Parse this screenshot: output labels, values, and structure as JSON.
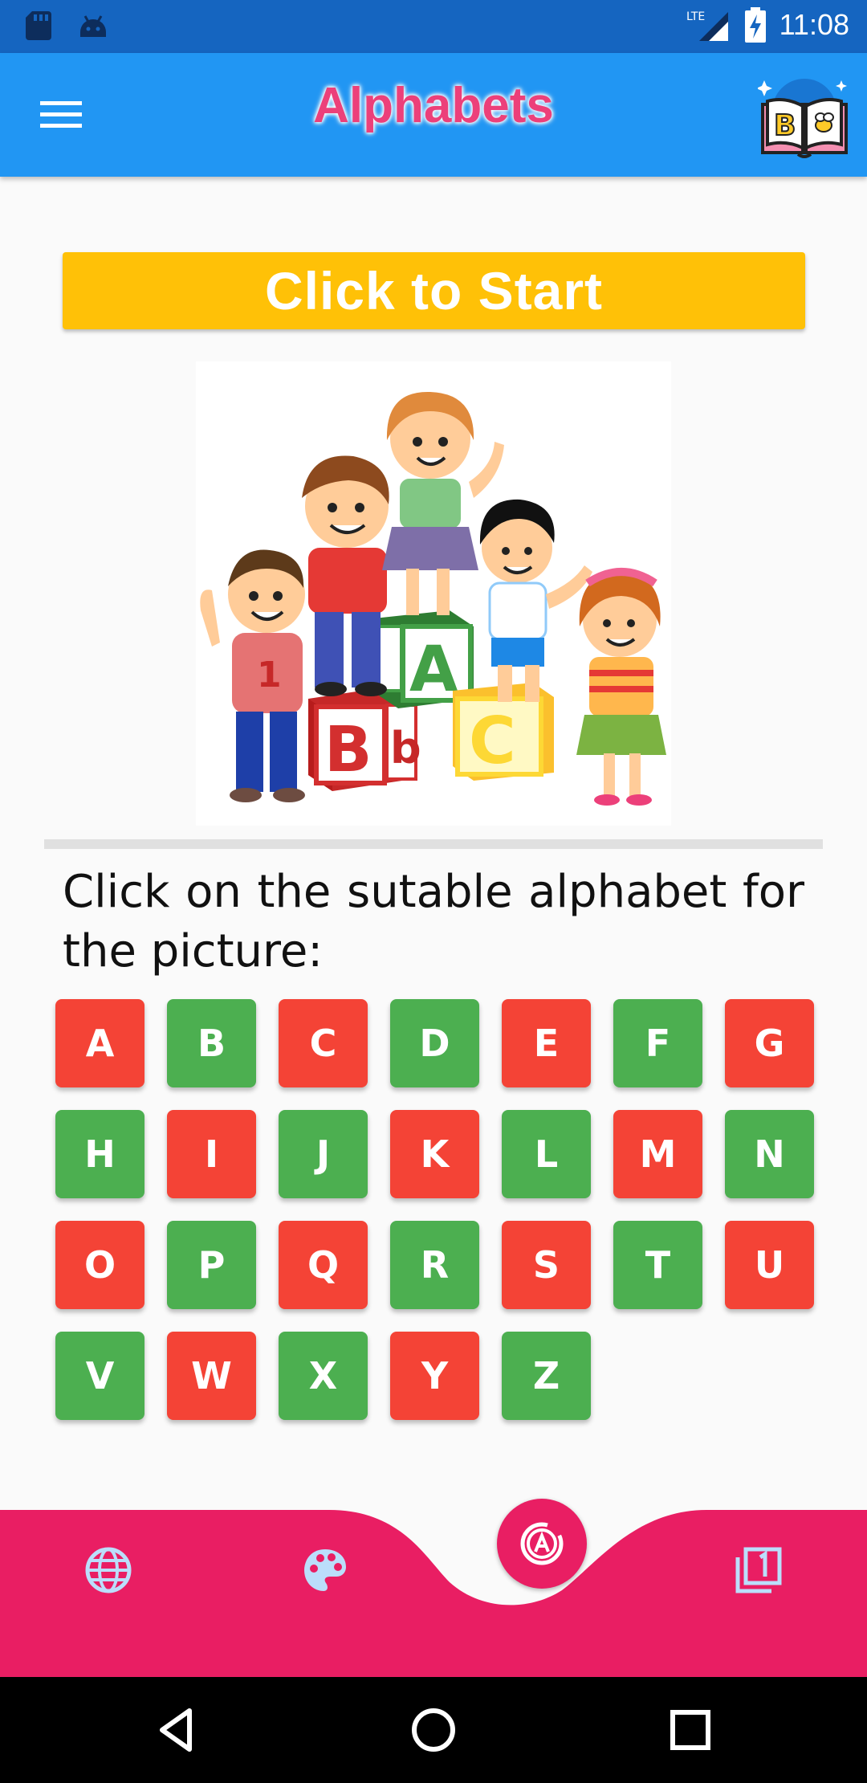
{
  "status_bar": {
    "time": "11:08",
    "network": "LTE",
    "left_icons": [
      "sd-card-icon",
      "android-icon"
    ],
    "right_icons": [
      "signal-icon",
      "battery-charging-icon"
    ]
  },
  "app_bar": {
    "title": "Alphabets",
    "menu_icon": "hamburger-menu-icon",
    "logo_icon": "book-logo-icon",
    "background": "#2196F3",
    "title_color": "#EC407A"
  },
  "start_button": {
    "label": "Click to Start",
    "color": "#FFC107"
  },
  "picture": {
    "icon": "children-with-abc-blocks-illustration"
  },
  "prompt": {
    "text": "Click on the sutable alphabet for the picture:"
  },
  "alphabet": {
    "colors": {
      "red": "#F44336",
      "green": "#4CAF50"
    },
    "letters": [
      {
        "label": "A",
        "color": "red"
      },
      {
        "label": "B",
        "color": "green"
      },
      {
        "label": "C",
        "color": "red"
      },
      {
        "label": "D",
        "color": "green"
      },
      {
        "label": "E",
        "color": "red"
      },
      {
        "label": "F",
        "color": "green"
      },
      {
        "label": "G",
        "color": "red"
      },
      {
        "label": "H",
        "color": "green"
      },
      {
        "label": "I",
        "color": "red"
      },
      {
        "label": "J",
        "color": "green"
      },
      {
        "label": "K",
        "color": "red"
      },
      {
        "label": "L",
        "color": "green"
      },
      {
        "label": "M",
        "color": "red"
      },
      {
        "label": "N",
        "color": "green"
      },
      {
        "label": "O",
        "color": "red"
      },
      {
        "label": "P",
        "color": "green"
      },
      {
        "label": "Q",
        "color": "red"
      },
      {
        "label": "R",
        "color": "green"
      },
      {
        "label": "S",
        "color": "red"
      },
      {
        "label": "T",
        "color": "green"
      },
      {
        "label": "U",
        "color": "red"
      },
      {
        "label": "V",
        "color": "green"
      },
      {
        "label": "W",
        "color": "red"
      },
      {
        "label": "X",
        "color": "green"
      },
      {
        "label": "Y",
        "color": "red"
      },
      {
        "label": "Z",
        "color": "green"
      }
    ]
  },
  "bottom_nav": {
    "color": "#E91E63",
    "items": [
      "globe-icon",
      "palette-icon",
      "alphabet-a-icon",
      "stack-one-icon"
    ],
    "active": "alphabet-a-icon"
  },
  "system_nav": [
    "back-icon",
    "home-icon",
    "recents-icon"
  ]
}
